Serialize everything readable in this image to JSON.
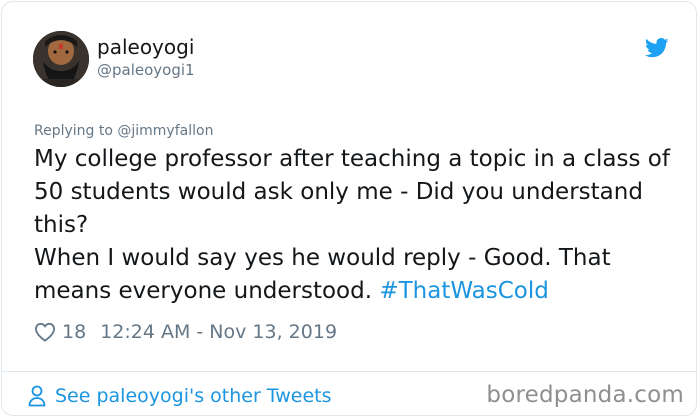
{
  "tweet": {
    "display_name": "paleoyogi",
    "handle": "@paleoyogi1",
    "replying_to": "Replying to @jimmyfallon",
    "text_line1": "My college professor after teaching a topic in a class of 50 students would ask only me - Did you understand this?",
    "text_line2_plain": "When I would say yes he would reply - Good. That means everyone understood. ",
    "hashtag": "#ThatWasCold",
    "likes": "18",
    "timestamp": "12:24 AM - Nov 13, 2019",
    "footer_link": "See paleoyogi's other Tweets"
  },
  "watermark": "boredpanda.com",
  "icons": {
    "brand": "twitter-bird-icon",
    "like": "heart-icon",
    "profile": "person-icon",
    "avatar": "avatar"
  },
  "colors": {
    "twitter_blue": "#1da1f2",
    "link_blue": "#1b95e0",
    "secondary_text": "#657786",
    "primary_text": "#14171a",
    "border": "#e1e8ed",
    "watermark": "#8f8f8f"
  }
}
